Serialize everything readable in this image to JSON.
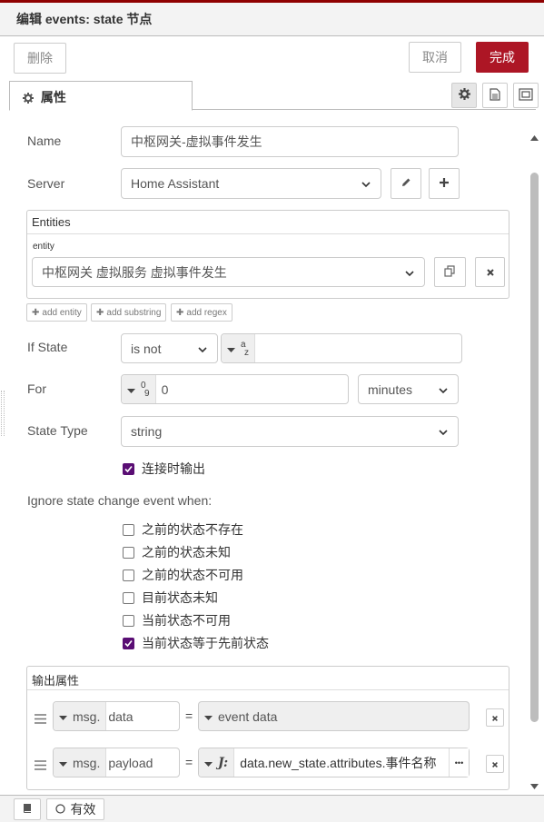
{
  "header": {
    "title": "编辑 events: state 节点"
  },
  "toolbar": {
    "delete_label": "删除",
    "cancel_label": "取消",
    "done_label": "完成"
  },
  "tabs": {
    "properties_label": "属性"
  },
  "form": {
    "name": {
      "label": "Name",
      "value": "中枢网关-虚拟事件发生"
    },
    "server": {
      "label": "Server",
      "value": "Home Assistant"
    },
    "entities": {
      "title": "Entities",
      "entity_label": "entity",
      "entity_value": "中枢网关 虚拟服务 虚拟事件发生",
      "add_entity": "add entity",
      "add_substring": "add substring",
      "add_regex": "add regex"
    },
    "if_state": {
      "label": "If State",
      "operator": "is not",
      "type_glyph_top": "a",
      "type_glyph_bottom": "z",
      "value": ""
    },
    "for": {
      "label": "For",
      "type_glyph_top": "0",
      "type_glyph_bottom": "9",
      "value": "0",
      "unit": "minutes"
    },
    "state_type": {
      "label": "State Type",
      "value": "string"
    },
    "output_on_connect": {
      "label": "连接时输出",
      "checked": true
    },
    "ignore": {
      "heading": "Ignore state change event when:",
      "options": [
        {
          "label": "之前的状态不存在",
          "checked": false
        },
        {
          "label": "之前的状态未知",
          "checked": false
        },
        {
          "label": "之前的状态不可用",
          "checked": false
        },
        {
          "label": "目前状态未知",
          "checked": false
        },
        {
          "label": "当前状态不可用",
          "checked": false
        },
        {
          "label": "当前状态等于先前状态",
          "checked": true
        }
      ]
    },
    "output_props": {
      "title": "输出属性",
      "rows": [
        {
          "prefix": "msg.",
          "property": "data",
          "equals": "=",
          "value": "event data"
        },
        {
          "prefix": "msg.",
          "property": "payload",
          "equals": "=",
          "value": "data.new_state.attributes.事件名称",
          "more": "•••"
        }
      ]
    }
  },
  "footer": {
    "enabled_label": "有效"
  },
  "colors": {
    "accent": "#ad1625",
    "checkbox": "#5a0e74",
    "stripe": "#8f0000"
  }
}
